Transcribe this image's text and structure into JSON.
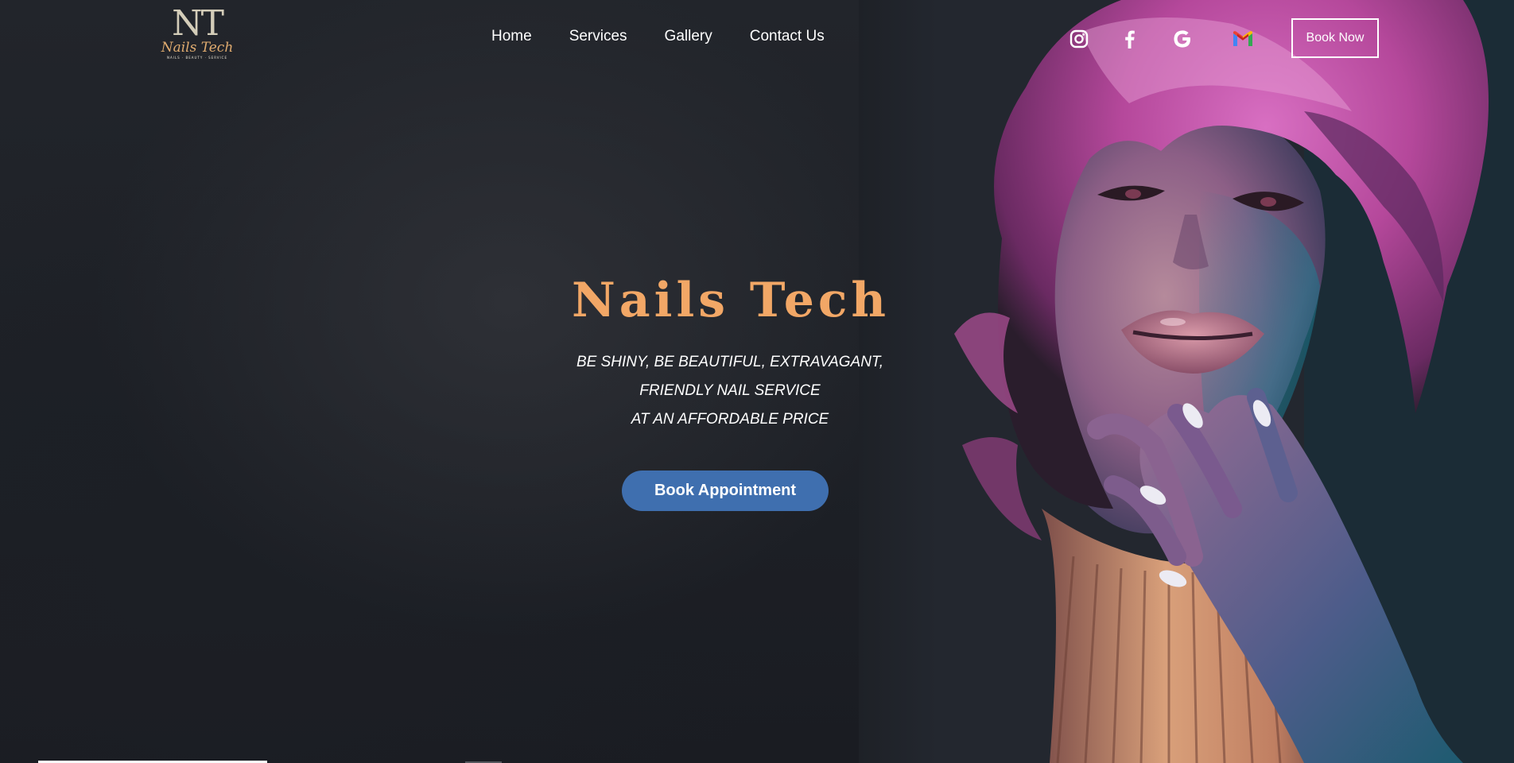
{
  "logo": {
    "monogram": "NT",
    "script": "Nails Tech",
    "tagline": "NAILS · BEAUTY · SERVICE"
  },
  "nav": {
    "items": [
      {
        "label": "Home"
      },
      {
        "label": "Services"
      },
      {
        "label": "Gallery"
      },
      {
        "label": "Contact Us"
      }
    ]
  },
  "socials": [
    {
      "name": "instagram-icon"
    },
    {
      "name": "facebook-icon"
    },
    {
      "name": "google-icon"
    },
    {
      "name": "gmail-icon"
    }
  ],
  "header": {
    "book_now_label": "Book Now"
  },
  "hero": {
    "title": "Nails Tech",
    "tagline_lines": [
      "BE SHINY, BE BEAUTIFUL, EXTRAVAGANT,",
      "FRIENDLY NAIL SERVICE",
      "AT AN AFFORDABLE PRICE"
    ],
    "cta_label": "Book Appointment"
  },
  "colors": {
    "background": "#1e2127",
    "title_accent": "#f2a766",
    "cta": "#3f6faf",
    "text": "#ffffff"
  }
}
